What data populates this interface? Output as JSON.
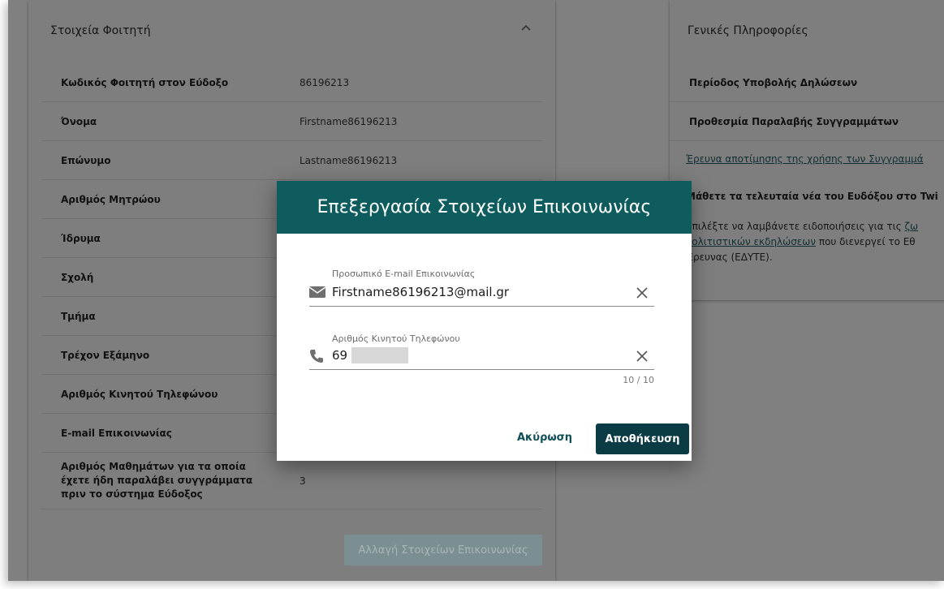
{
  "student_card": {
    "title": "Στοιχεία Φοιτητή",
    "rows": [
      {
        "label": "Κωδικός Φοιτητή στον Εύδοξο",
        "value": "86196213"
      },
      {
        "label": "Όνομα",
        "value": "Firstname86196213"
      },
      {
        "label": "Επώνυμο",
        "value": "Lastname86196213"
      },
      {
        "label": "Αριθμός Μητρώου",
        "value": ""
      },
      {
        "label": "Ίδρυμα",
        "value": ""
      },
      {
        "label": "Σχολή",
        "value": ""
      },
      {
        "label": "Τμήμα",
        "value": ""
      },
      {
        "label": "Τρέχον Εξάμηνο",
        "value": ""
      },
      {
        "label": "Αριθμός Κινητού Τηλεφώνου",
        "value": ""
      },
      {
        "label": "E-mail Επικοινωνίας",
        "value": ""
      },
      {
        "label": "Αριθμός Μαθημάτων για τα οποία έχετε ήδη παραλάβει συγγράμματα πριν το σύστημα Εύδοξος",
        "value": "3"
      }
    ],
    "change_button": "Αλλαγή Στοιχείων Επικοινωνίας"
  },
  "info_card": {
    "title": "Γενικές Πληροφορίες",
    "rows": [
      "Περίοδος Υποβολής Δηλώσεων",
      "Προθεσμία Παραλαβής Συγγραμμάτων"
    ],
    "survey_link": "Έρευνα αποτίμησης της χρήσης των Συγγραμμά",
    "twitter_text": "Μάθετε τα τελευταία νέα του Ευδόξου στο Twi",
    "notify_text_1": "Επιλέξτε να λαμβάνετε ειδοποιήσεις για τις ",
    "notify_link_1": "ζω",
    "notify_link_2": "πολιτιστικών εκδηλώσεων",
    "notify_text_2": " που διενεργεί το Εθ",
    "notify_text_3": "Έρευνας (ΕΔΥΤΕ)."
  },
  "modal": {
    "title": "Επεξεργασία Στοιχείων Επικοινωνίας",
    "email_label": "Προσωπικό E-mail Επικοινωνίας",
    "email_value": "Firstname86196213@mail.gr",
    "phone_label": "Αριθμός Κινητού Τηλεφώνου",
    "phone_value": "69",
    "phone_counter": "10 / 10",
    "cancel_label": "Ακύρωση",
    "save_label": "Αποθήκευση"
  },
  "colors": {
    "modal_header": "#0e5c5d",
    "save_button": "#0b3c45",
    "overlay": "#808080"
  }
}
